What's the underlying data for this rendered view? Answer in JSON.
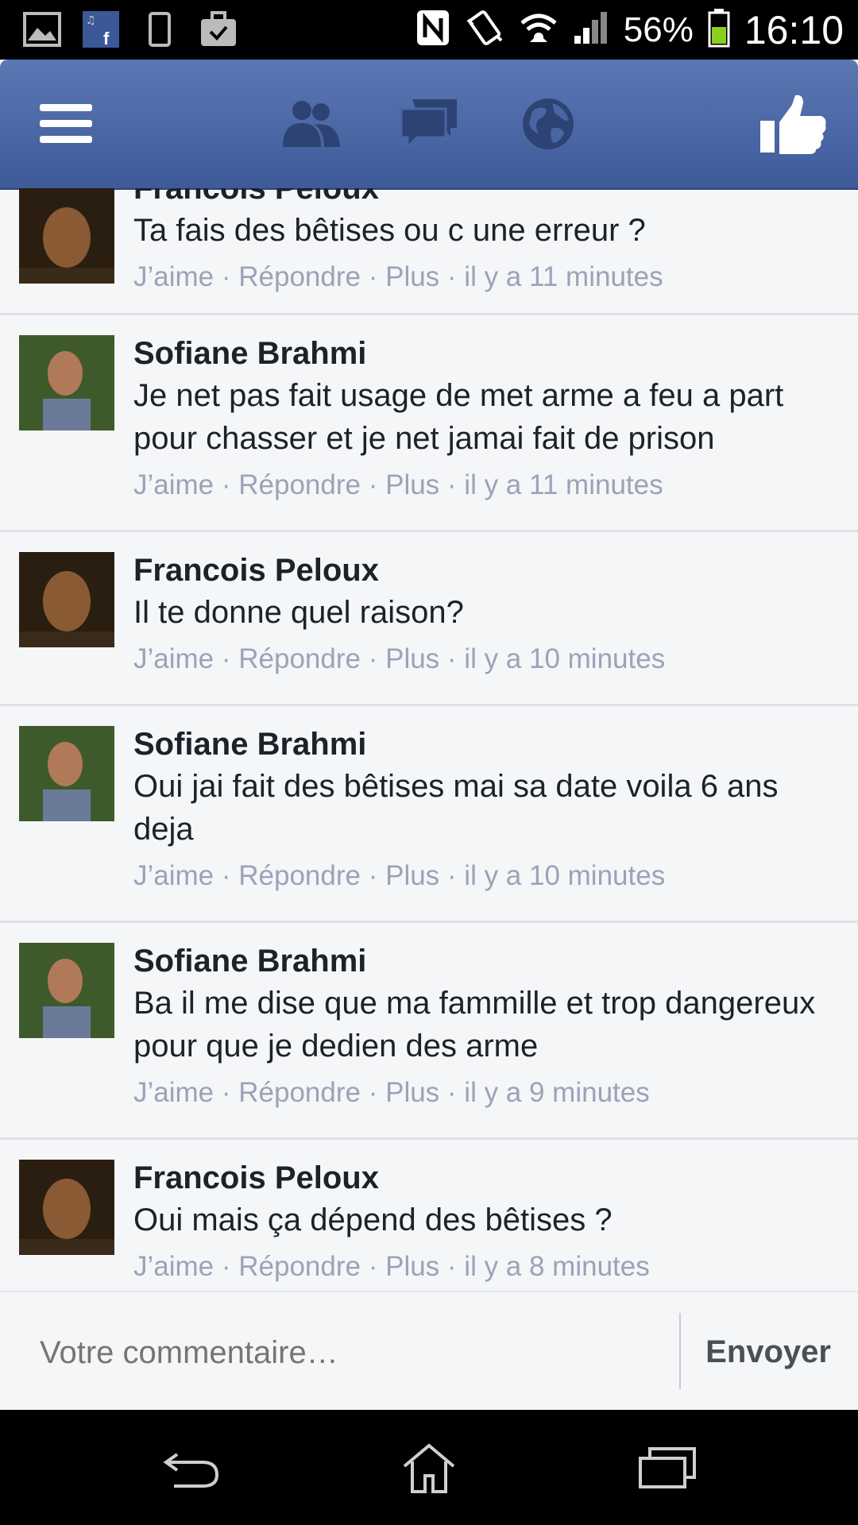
{
  "status_bar": {
    "battery": "56%",
    "time": "16:10",
    "left_icons": [
      "gallery-icon",
      "facebook-music-icon",
      "phone-device-icon",
      "briefcase-icon"
    ],
    "right_icons": [
      "nfc-icon",
      "vibrate-icon",
      "wifi-icon",
      "signal-icon",
      "battery-icon"
    ]
  },
  "app_bar": {
    "icons": [
      "menu-icon",
      "friends-icon",
      "messages-icon",
      "globe-icon",
      "like-icon"
    ],
    "colors": {
      "top": "#5b78b5",
      "bottom": "#3e5a98",
      "icon": "#2d4373",
      "icon_white": "#ffffff"
    }
  },
  "comments": [
    {
      "author": "Francois Peloux",
      "text": "Ta fais des bêtises ou c une erreur ?",
      "like": "J’aime",
      "reply": "Répondre",
      "more": "Plus",
      "time": "il y a 11 minutes"
    },
    {
      "author": "Sofiane Brahmi",
      "text": "Je net pas fait usage de met arme a feu a part pour chasser et je net jamai fait de prison",
      "like": "J’aime",
      "reply": "Répondre",
      "more": "Plus",
      "time": "il y a 11 minutes"
    },
    {
      "author": "Francois Peloux",
      "text": "Il te donne quel raison?",
      "like": "J’aime",
      "reply": "Répondre",
      "more": "Plus",
      "time": "il y a 10 minutes"
    },
    {
      "author": "Sofiane Brahmi",
      "text": "Oui jai fait des bêtises mai sa date voila 6 ans deja",
      "like": "J’aime",
      "reply": "Répondre",
      "more": "Plus",
      "time": "il y a 10 minutes"
    },
    {
      "author": "Sofiane Brahmi",
      "text": "Ba il me dise que ma fammille et trop dangereux pour que je dedien des arme",
      "like": "J’aime",
      "reply": "Répondre",
      "more": "Plus",
      "time": "il y a 9 minutes"
    },
    {
      "author": "Francois Peloux",
      "text": "Oui mais ça dépend des bêtises ?",
      "like": "J’aime",
      "reply": "Répondre",
      "more": "Plus",
      "time": "il y a 8 minutes"
    }
  ],
  "composer": {
    "placeholder": "Votre commentaire…",
    "send_label": "Envoyer"
  },
  "nav_bar": {
    "icons": [
      "back-icon",
      "home-icon",
      "recent-apps-icon"
    ]
  }
}
